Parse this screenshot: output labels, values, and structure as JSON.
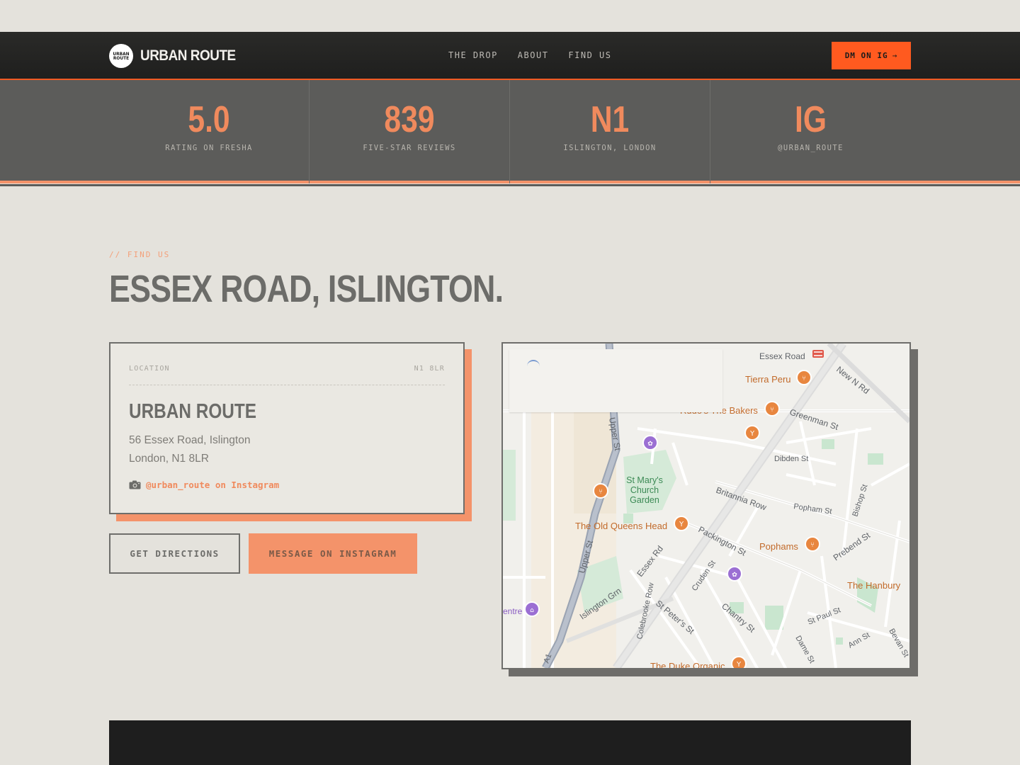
{
  "brand": {
    "logo_mark_line1": "URBAN",
    "logo_mark_line2": "ROUTE",
    "name": "URBAN ROUTE",
    "accent": "#f15a24"
  },
  "nav": {
    "items": [
      "THE DROP",
      "ABOUT",
      "FIND US"
    ],
    "cta_label": "DM ON IG",
    "cta_arrow": "→"
  },
  "stats": [
    {
      "value": "5.0",
      "label": "RATING ON FRESHA"
    },
    {
      "value": "839",
      "label": "FIVE-STAR REVIEWS"
    },
    {
      "value": "N1",
      "label": "ISLINGTON, LONDON"
    },
    {
      "value": "IG",
      "label": "@URBAN_ROUTE"
    }
  ],
  "find_us": {
    "eyebrow": "// FIND US",
    "title": "ESSEX ROAD, ISLINGTON.",
    "card": {
      "location_label": "LOCATION",
      "postcode": "N1 8LR",
      "name": "URBAN ROUTE",
      "address_line1": "56 Essex Road, Islington",
      "address_line2": "London, N1 8LR",
      "instagram_text": "@urban_route on Instagram",
      "instagram_icon": "camera-icon"
    },
    "buttons": {
      "directions": "GET DIRECTIONS",
      "message": "MESSAGE ON INSTAGRAM"
    }
  },
  "map": {
    "labels": {
      "essex_road_station": "Essex Road",
      "tierra_peru": "Tierra Peru",
      "bakers": "Rudo's The Bakers",
      "greenman": "Greenman St",
      "new_n_rd": "New N Rd",
      "upper_st": "Upper St",
      "dibden": "Dibden St",
      "st_marys": "St Mary's",
      "church": "Church",
      "garden": "Garden",
      "britannia": "Britannia Row",
      "popham": "Popham St",
      "bishop": "Bishop St",
      "old_queens": "The Old Queens Head",
      "packington": "Packington St",
      "pophams": "Pophams",
      "prebend": "Prebend St",
      "upper_st_2": "Upper St",
      "essex_rd": "Essex Rd",
      "cruden": "Cruden St",
      "hanbury": "The Hanbury",
      "colebrooke": "Colebrooke Row",
      "islington_grn": "Islington Grn",
      "st_peters": "St Peter's St",
      "chantry": "Chantry St",
      "st_paul": "St Paul St",
      "centre": "entre",
      "dame": "Dame St",
      "ann": "Ann St",
      "bevan": "Bevan St",
      "a1": "A1",
      "duke": "The Duke Organic"
    }
  }
}
